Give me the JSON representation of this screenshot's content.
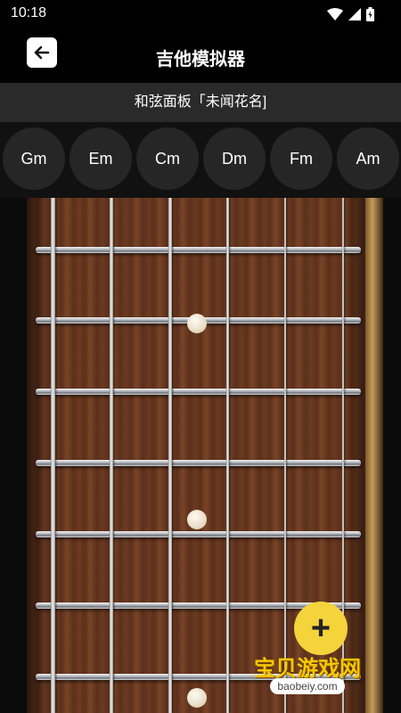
{
  "status_bar": {
    "time": "10:18"
  },
  "app_bar": {
    "title": "吉他模拟器"
  },
  "sub_header": {
    "text": "和弦面板「未闻花名]"
  },
  "chords": [
    {
      "label": "Gm"
    },
    {
      "label": "Em"
    },
    {
      "label": "Cm"
    },
    {
      "label": "Dm"
    },
    {
      "label": "Fm"
    },
    {
      "label": "Am"
    }
  ],
  "watermark": {
    "text": "宝贝游戏网",
    "url": "baobeiy.com"
  },
  "colors": {
    "background": "#000000",
    "chord_button": "#262626",
    "fretboard_wood": "#5e321c",
    "watermark_yellow": "#f5d33a"
  }
}
